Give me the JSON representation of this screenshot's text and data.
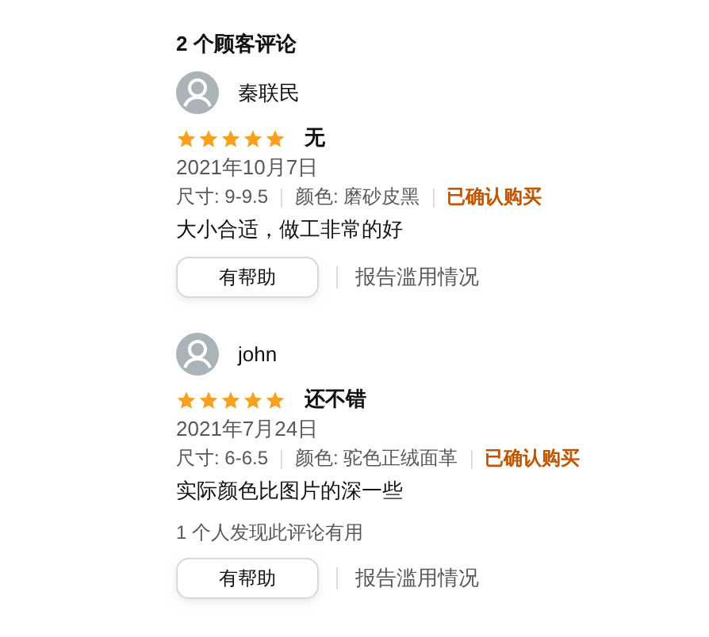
{
  "heading": "2 个顾客评论",
  "reviews": [
    {
      "author": "秦联民",
      "stars": 5,
      "title": "无",
      "date": "2021年10月7日",
      "size": "尺寸: 9-9.5",
      "variant": "颜色: 磨砂皮黑",
      "verified": "已确认购买",
      "body": "大小合适，做工非常的好",
      "helpful_button": "有帮助",
      "report": "报告滥用情况"
    },
    {
      "author": "john",
      "stars": 5,
      "title": "还不错",
      "date": "2021年7月24日",
      "size": "尺寸: 6-6.5",
      "variant": "颜色: 驼色正绒面革",
      "verified": "已确认购买",
      "body": "实际颜色比图片的深一些",
      "helpful_count": "1 个人发现此评论有用",
      "helpful_button": "有帮助",
      "report": "报告滥用情况"
    }
  ]
}
